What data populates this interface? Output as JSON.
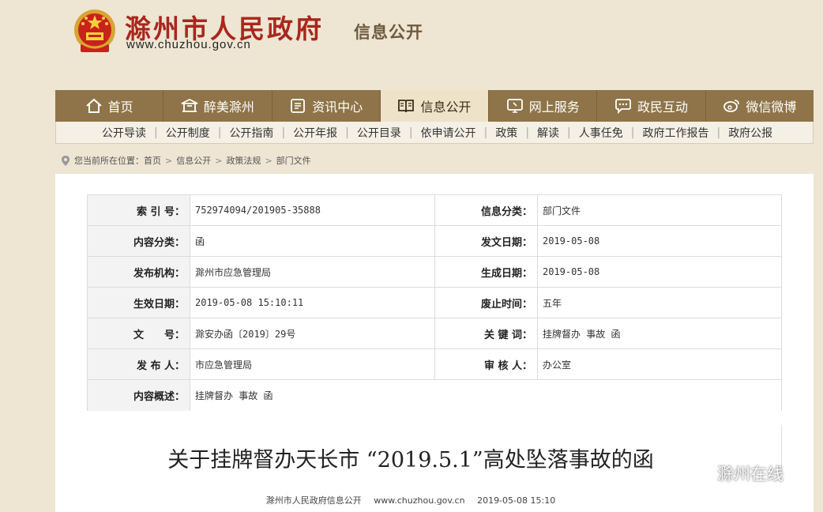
{
  "header": {
    "title": "滁州市人民政府",
    "subtitle": "信息公开",
    "url": "www.chuzhou.gov.cn"
  },
  "nav": {
    "items": [
      {
        "label": "首页",
        "icon": "home-icon"
      },
      {
        "label": "醉美滁州",
        "icon": "pavilion-icon"
      },
      {
        "label": "资讯中心",
        "icon": "news-icon"
      },
      {
        "label": "信息公开",
        "icon": "book-icon"
      },
      {
        "label": "网上服务",
        "icon": "monitor-icon"
      },
      {
        "label": "政民互动",
        "icon": "chat-icon"
      },
      {
        "label": "微信微博",
        "icon": "weibo-icon"
      }
    ]
  },
  "subnav": {
    "items": [
      "公开导读",
      "公开制度",
      "公开指南",
      "公开年报",
      "公开目录",
      "依申请公开",
      "政策",
      "解读",
      "人事任免",
      "政府工作报告",
      "政府公报"
    ]
  },
  "breadcrumb": {
    "prefix": "您当前所在位置：",
    "items": [
      "首页",
      "信息公开",
      "政策法规",
      "部门文件"
    ]
  },
  "meta_table": {
    "rows": [
      {
        "l1": "索 引 号：",
        "v1": "752974094/201905-35888",
        "l2": "信息分类：",
        "v2": "部门文件"
      },
      {
        "l1": "内容分类：",
        "v1": "函",
        "l2": "发文日期：",
        "v2": "2019-05-08"
      },
      {
        "l1": "发布机构：",
        "v1": "滁州市应急管理局",
        "l2": "生成日期：",
        "v2": "2019-05-08"
      },
      {
        "l1": "生效日期：",
        "v1": "2019-05-08 15:10:11",
        "l2": "废止时间：",
        "v2": "五年"
      },
      {
        "l1": "文　　号：",
        "v1": "滁安办函〔2019〕29号",
        "l2": "关 键 词：",
        "v2": "挂牌督办 事故 函"
      },
      {
        "l1": "发 布 人：",
        "v1": "市应急管理局",
        "l2": "审 核 人：",
        "v2": "办公室"
      },
      {
        "l1": "内容概述：",
        "v1": "挂牌督办 事故 函"
      }
    ]
  },
  "document": {
    "title": "关于挂牌督办天长市 “2019.5.1”高处坠落事故的函",
    "source": "滁州市人民政府信息公开",
    "site": "www.chuzhou.gov.cn",
    "date": "2019-05-08 15:10"
  },
  "watermark": {
    "text": "滁州在线"
  },
  "colors": {
    "brand_red": "#a8271c",
    "nav_bg": "#8e7448",
    "nav_active_bg": "#eee2c9",
    "page_bg": "#eee5d3"
  }
}
